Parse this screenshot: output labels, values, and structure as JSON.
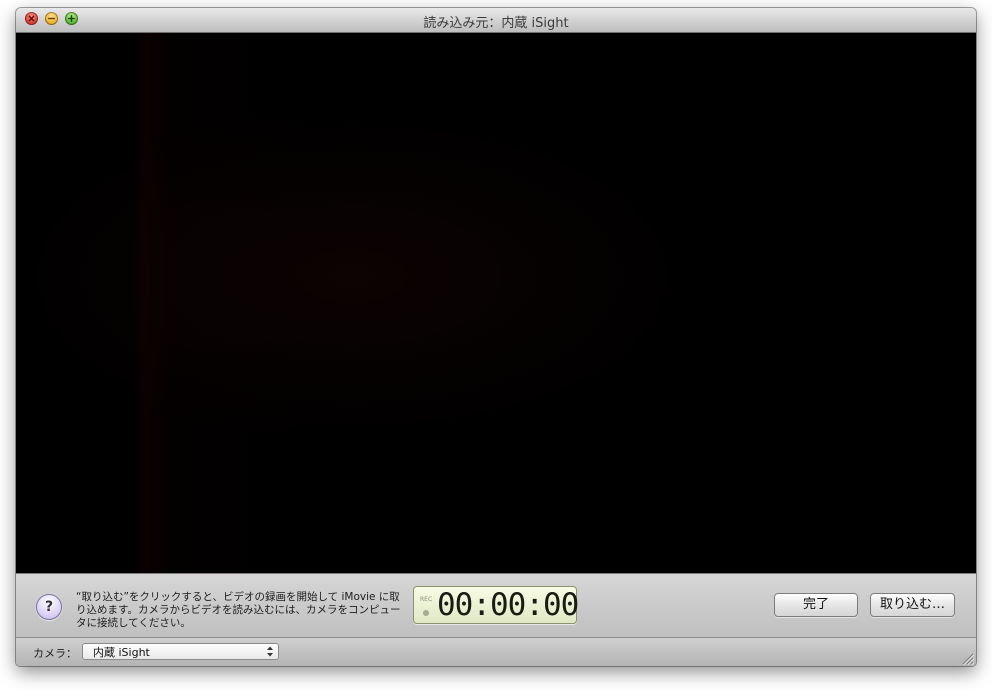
{
  "window": {
    "title": "読み込み元：内蔵 iSight"
  },
  "control_bar": {
    "help_label": "?",
    "instructions": "“取り込む”をクリックすると、ビデオの録画を開始して iMovie に取り込めます。カメラからビデオを読み込むには、カメラをコンピュータに接続してください。",
    "rec_label": "REC",
    "timecode": "00:00:00",
    "done_label": "完了",
    "import_label": "取り込む…"
  },
  "bottom_bar": {
    "camera_label": "カメラ：",
    "camera_selected": "内蔵 iSight"
  },
  "icons": {
    "close": "close-icon",
    "minimize": "minimize-icon",
    "zoom": "zoom-icon",
    "help": "help-icon",
    "rec": "record-dot-icon",
    "popup": "updown-arrows-icon",
    "resize": "resize-grip-icon"
  },
  "colors": {
    "lcd_background": "#eef3d6",
    "video_background": "#000000",
    "help_button": "#dcd2f4"
  }
}
